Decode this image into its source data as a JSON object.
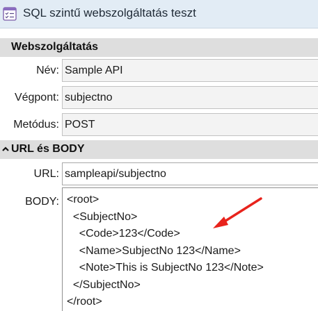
{
  "window": {
    "title": "SQL szintű webszolgáltatás teszt",
    "icon": "form-list-icon"
  },
  "sections": {
    "webservice": {
      "title": "Webszolgáltatás"
    },
    "url_body": {
      "title": "URL és BODY",
      "icon": "chevron-up-icon"
    }
  },
  "fields": {
    "name": {
      "label": "Név:",
      "value": "Sample API"
    },
    "endpoint": {
      "label": "Végpont:",
      "value": "subjectno"
    },
    "method": {
      "label": "Metódus:",
      "value": "POST"
    },
    "url": {
      "label": "URL:",
      "value": "sampleapi/subjectno"
    },
    "body": {
      "label": "BODY:",
      "lines": [
        "<root>",
        "  <SubjectNo>",
        "    <Code>123</Code>",
        "    <Name>SubjectNo 123</Name>",
        "    <Note>This is SubjectNo 123</Note>",
        "  </SubjectNo>",
        "</root>"
      ]
    }
  },
  "annotation": {
    "type": "red-arrow",
    "color": "#e8231c",
    "points_to": "<Code>123</Code>"
  },
  "colors": {
    "titlebar_bg": "#e2ecf5",
    "section_bg": "#dedede",
    "readonly_field_bg": "#f3f3f3",
    "editable_field_bg": "#ffffff"
  }
}
